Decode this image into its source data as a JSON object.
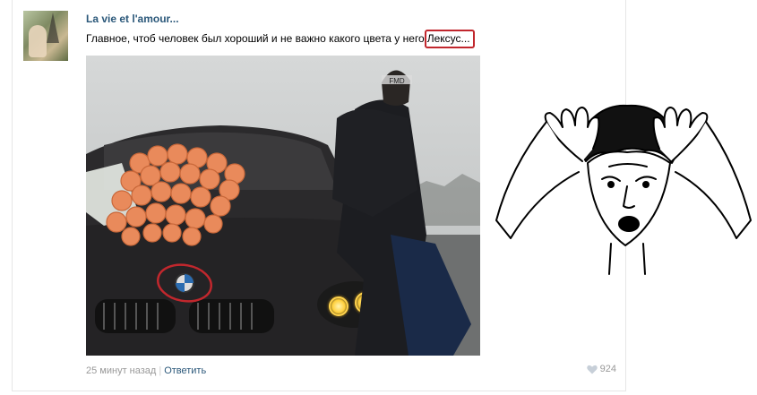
{
  "post": {
    "author": "La vie et l'amour...",
    "text_before": "Главное, чтоб человек был хороший и не важно какого цвета у него",
    "text_highlight": "Лексус...",
    "timestamp": "25 минут назад",
    "separator": "|",
    "reply_label": "Ответить",
    "likes_count": "924"
  },
  "photo": {
    "beanie_text": "FMD"
  },
  "icons": {
    "like": "heart-icon"
  },
  "colors": {
    "link": "#2b587a",
    "annotation": "#c1272d",
    "meta": "#999999"
  }
}
